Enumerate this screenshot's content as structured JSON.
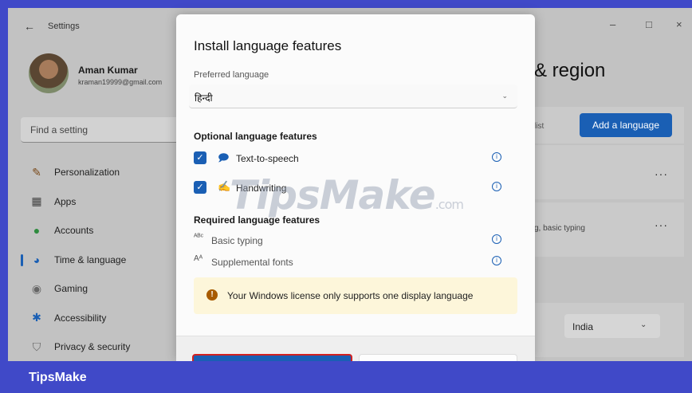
{
  "window": {
    "back_glyph": "←",
    "app_title": "Settings",
    "minimize_glyph": "–",
    "maximize_glyph": "□",
    "close_glyph": "×"
  },
  "profile": {
    "name": "Aman Kumar",
    "email": "kraman19999@gmail.com"
  },
  "search": {
    "placeholder": "Find a setting"
  },
  "nav": {
    "items": [
      {
        "label": "Personalization",
        "icon": "paintbrush-icon",
        "glyph": "✎",
        "color": "#7a4a1a"
      },
      {
        "label": "Apps",
        "icon": "apps-icon",
        "glyph": "▦",
        "color": "#444"
      },
      {
        "label": "Accounts",
        "icon": "accounts-icon",
        "glyph": "●",
        "color": "#2e8b3e"
      },
      {
        "label": "Time & language",
        "icon": "globe-clock-icon",
        "glyph": "◕",
        "color": "#1a5fb4",
        "active": true
      },
      {
        "label": "Gaming",
        "icon": "gamepad-icon",
        "glyph": "◉",
        "color": "#666"
      },
      {
        "label": "Accessibility",
        "icon": "accessibility-icon",
        "glyph": "✱",
        "color": "#1a5fb4"
      },
      {
        "label": "Privacy & security",
        "icon": "shield-icon",
        "glyph": "⛉",
        "color": "#666"
      }
    ]
  },
  "main": {
    "heading_fragment": "& region",
    "list_fragment": "list",
    "add_language_label": "Add a language",
    "more_glyph": "···",
    "card2_fragment": "g, basic typing",
    "country_value": "India",
    "country_chevron": "⌄"
  },
  "dialog": {
    "title": "Install language features",
    "preferred_label": "Preferred language",
    "preferred_value": "हिन्दी",
    "preferred_chevron": "⌄",
    "optional_heading": "Optional language features",
    "optional": [
      {
        "label": "Text-to-speech",
        "icon": "text-to-speech-icon",
        "glyph": "🗩",
        "checked": true,
        "check_glyph": "✓",
        "info_glyph": "i"
      },
      {
        "label": "Handwriting",
        "icon": "handwriting-icon",
        "glyph": "✍",
        "checked": true,
        "check_glyph": "✓",
        "info_glyph": "i"
      }
    ],
    "required_heading": "Required language features",
    "required": [
      {
        "label": "Basic typing",
        "icon": "basic-typing-icon",
        "glyph": "ᴬᴮᶜ",
        "info_glyph": "i"
      },
      {
        "label": "Supplemental fonts",
        "icon": "fonts-icon",
        "glyph": "Aᴬ",
        "info_glyph": "i"
      }
    ],
    "warning_glyph": "!",
    "warning_text": "Your Windows license only supports one display language"
  },
  "watermark": {
    "main": "TipsMake",
    "suffix": ".com"
  },
  "footer": {
    "brand": "TipsMake"
  },
  "colors": {
    "accent": "#1a5fb4",
    "brand_bar": "#4049c8",
    "warning_bg": "#fdf6da",
    "warning_icon": "#a85b00",
    "install_outline": "#d32020"
  }
}
